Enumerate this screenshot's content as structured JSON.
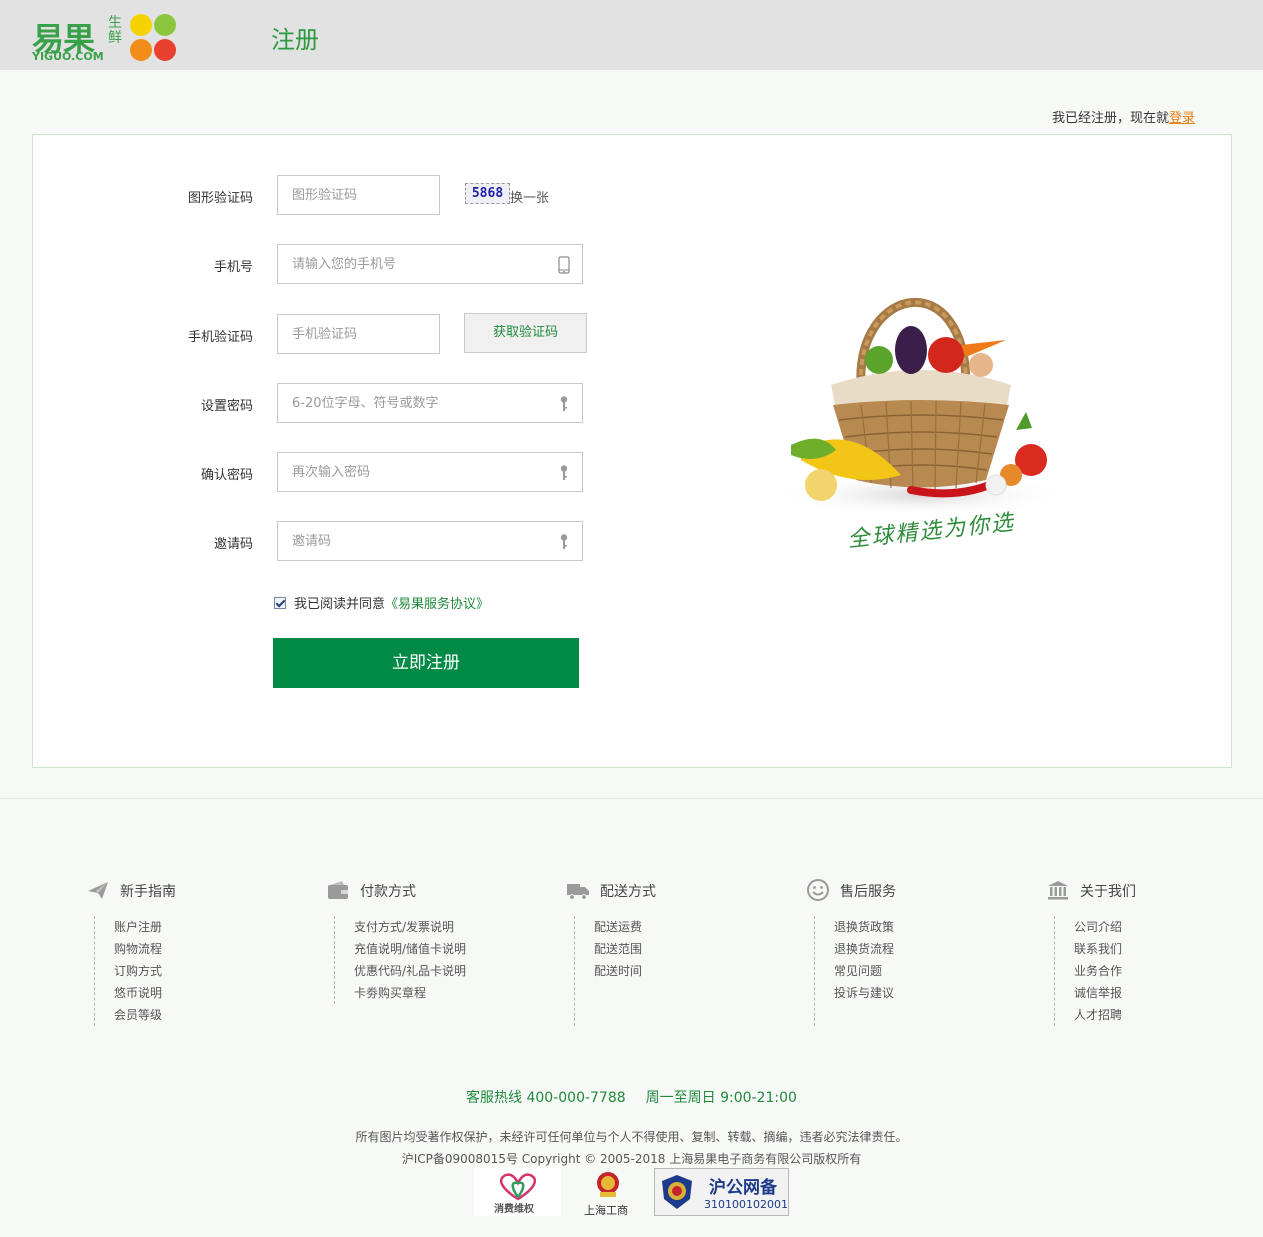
{
  "header": {
    "logo_main": "易果",
    "logo_sub": "生鲜",
    "logo_domain": "YIGUO.COM",
    "page_title": "注册",
    "logo_colors": [
      "#f6d200",
      "#8cc63f",
      "#f28d1a",
      "#e8412f"
    ]
  },
  "login_hint": {
    "text": "我已经注册，现在就",
    "link": "登录"
  },
  "form": {
    "captcha": {
      "label": "图形验证码",
      "placeholder": "图形验证码",
      "image_text": "5868",
      "refresh": "换一张"
    },
    "phone": {
      "label": "手机号",
      "placeholder": "请输入您的手机号",
      "icon": "mobile-icon"
    },
    "sms": {
      "label": "手机验证码",
      "placeholder": "手机验证码",
      "button": "获取验证码"
    },
    "password": {
      "label": "设置密码",
      "placeholder": "6-20位字母、符号或数字",
      "icon": "key-icon"
    },
    "confirm": {
      "label": "确认密码",
      "placeholder": "再次输入密码",
      "icon": "key-icon"
    },
    "invite": {
      "label": "邀请码",
      "placeholder": "邀请码",
      "icon": "key-icon"
    },
    "agree": {
      "checked": true,
      "text": "我已阅读并同意",
      "link": "《易果服务协议》"
    },
    "submit": "立即注册"
  },
  "promo": {
    "slogan": "全球精选为你选"
  },
  "footer": {
    "columns": [
      {
        "title": "新手指南",
        "icon": "paper-plane-icon",
        "items": [
          "账户注册",
          "购物流程",
          "订购方式",
          "悠币说明",
          "会员等级"
        ]
      },
      {
        "title": "付款方式",
        "icon": "wallet-icon",
        "items": [
          "支付方式/发票说明",
          "充值说明/储值卡说明",
          "优惠代码/礼品卡说明",
          "卡劵购买章程"
        ]
      },
      {
        "title": "配送方式",
        "icon": "truck-icon",
        "items": [
          "配送运费",
          "配送范围",
          "配送时间"
        ]
      },
      {
        "title": "售后服务",
        "icon": "smiley-icon",
        "items": [
          "退换货政策",
          "退换货流程",
          "常见问题",
          "投诉与建议"
        ]
      },
      {
        "title": "关于我们",
        "icon": "bank-icon",
        "items": [
          "公司介绍",
          "联系我们",
          "业务合作",
          "诚信举报",
          "人才招聘"
        ]
      }
    ],
    "hotline": "客服热线 400-000-7788",
    "hours": "周一至周日 9:00-21:00",
    "copyright1": "所有图片均受著作权保护，未经许可任何单位与个人不得使用、复制、转载、摘编，违者必究法律责任。",
    "copyright2": "沪ICP备09008015号 Copyright © 2005-2018 上海易果电子商务有限公司版权所有",
    "badges": {
      "consumer": "消费维权",
      "icbc": "上海工商",
      "police_title": "沪公网备",
      "police_number": "310100102001"
    }
  },
  "colors": {
    "brand_green": "#008a45",
    "link_orange": "#e87d12",
    "header_bg": "#e2e2e2"
  }
}
